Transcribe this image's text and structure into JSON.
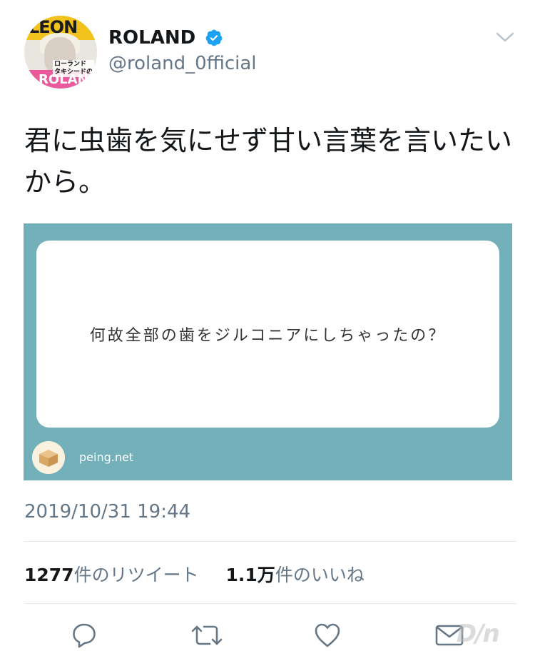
{
  "user": {
    "display_name": "ROLAND",
    "handle": "@roland_0fficial",
    "avatar": {
      "magazine_title": "LEON",
      "cover_text": "ローランド\nタキシードの",
      "bottom_text": "ROLAND"
    }
  },
  "tweet": {
    "text": "君に虫歯を気にせず甘い言葉を言いたいから。",
    "card": {
      "question": "何故全部の歯をジルコニアにしちゃったの？",
      "site": "peing.net",
      "background_color": "#73b0b9"
    },
    "timestamp": "2019/10/31 19:44",
    "retweets": {
      "count": "1277",
      "label": "件のリツイート"
    },
    "likes": {
      "count": "1.1万",
      "label": "件のいいね"
    }
  },
  "icons": [
    "verified-badge-icon",
    "chevron-down-icon",
    "reply-icon",
    "retweet-icon",
    "like-icon",
    "share-icon"
  ],
  "watermark": "D/n"
}
